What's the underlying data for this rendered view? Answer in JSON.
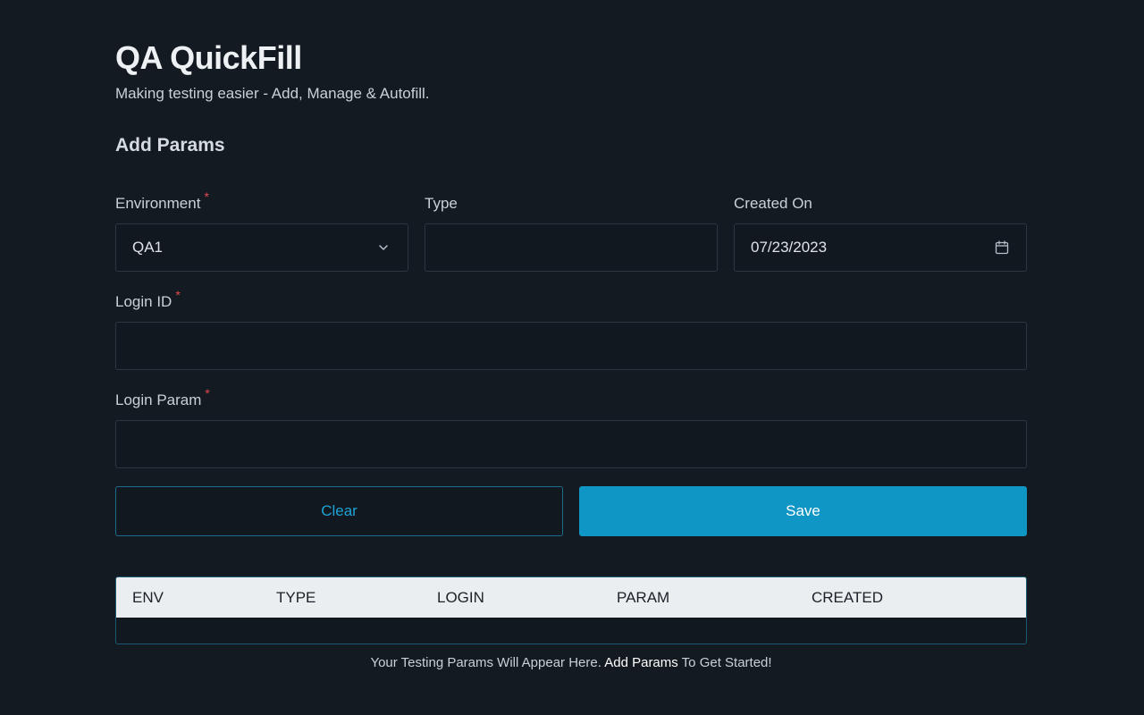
{
  "app": {
    "title": "QA QuickFill",
    "subtitle": "Making testing easier - Add, Manage & Autofill."
  },
  "form": {
    "section_title": "Add Params",
    "required_marker": "*",
    "environment": {
      "label": "Environment",
      "required": true,
      "value": "QA1",
      "icon": "chevron-down-icon"
    },
    "type": {
      "label": "Type",
      "required": false,
      "value": ""
    },
    "created_on": {
      "label": "Created On",
      "required": false,
      "value": "07/23/2023",
      "icon": "calendar-icon"
    },
    "login_id": {
      "label": "Login ID",
      "required": true,
      "value": ""
    },
    "login_param": {
      "label": "Login Param",
      "required": true,
      "value": ""
    },
    "clear_label": "Clear",
    "save_label": "Save"
  },
  "table": {
    "columns": [
      "ENV",
      "TYPE",
      "LOGIN",
      "PARAM",
      "CREATED"
    ],
    "rows": []
  },
  "empty_state": {
    "prefix": "Your Testing Params Will Appear Here. ",
    "link": "Add Params",
    "suffix": " To Get Started!"
  },
  "colors": {
    "background": "#141a21",
    "accent": "#0f96c4",
    "required": "#e5484d",
    "table_header": "#ebeef1"
  }
}
